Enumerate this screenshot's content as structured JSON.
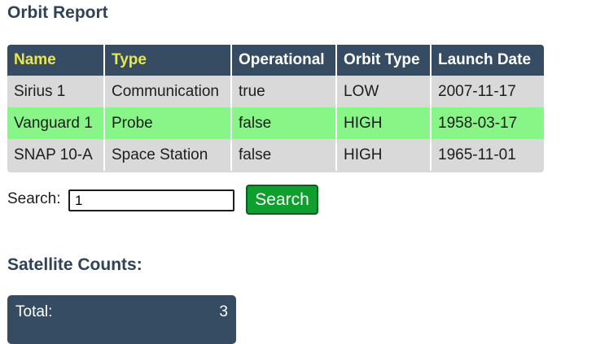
{
  "report": {
    "title": "Orbit Report"
  },
  "table": {
    "headers": [
      "Name",
      "Type",
      "Operational",
      "Orbit Type",
      "Launch Date"
    ],
    "rows": [
      [
        "Sirius 1",
        "Communication",
        "true",
        "LOW",
        "2007-11-17"
      ],
      [
        "Vanguard 1",
        "Probe",
        "false",
        "HIGH",
        "1958-03-17"
      ],
      [
        "SNAP 10-A",
        "Space Station",
        "false",
        "HIGH",
        "1965-11-01"
      ]
    ]
  },
  "colors": {
    "header_bg": "#354c63",
    "header_highlight_text": "#e8e84a",
    "highlight_row_bg": "#88f588",
    "table_bg": "#d9d9d9",
    "button_bg": "#0f9f2f"
  },
  "search": {
    "label": "Search:",
    "value": "1",
    "button_label": "Search"
  },
  "counts": {
    "title": "Satellite Counts:",
    "total_label": "Total:",
    "total_value": "3"
  }
}
